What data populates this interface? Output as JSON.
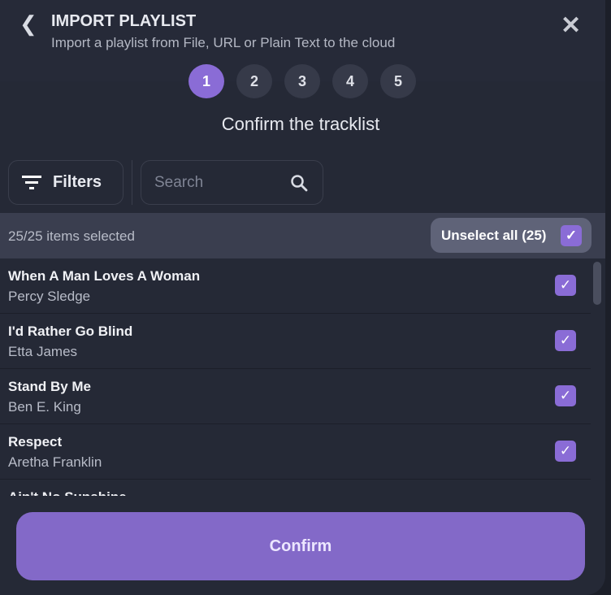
{
  "header": {
    "title": "IMPORT PLAYLIST",
    "subtitle": "Import a playlist from File, URL or Plain Text to the cloud"
  },
  "steps": [
    "1",
    "2",
    "3",
    "4",
    "5"
  ],
  "active_step": 1,
  "heading": "Confirm the tracklist",
  "toolbar": {
    "filters_label": "Filters",
    "search_placeholder": "Search"
  },
  "selection": {
    "count_text": "25/25 items selected",
    "unselect_label": "Unselect all (25)"
  },
  "tracks": [
    {
      "title": "When A Man Loves A Woman",
      "artist": "Percy Sledge",
      "checked": true
    },
    {
      "title": "I'd Rather Go Blind",
      "artist": "Etta James",
      "checked": true
    },
    {
      "title": "Stand By Me",
      "artist": "Ben E. King",
      "checked": true
    },
    {
      "title": "Respect",
      "artist": "Aretha Franklin",
      "checked": true
    },
    {
      "title": "Ain't No Sunshine",
      "artist": "",
      "checked": true
    }
  ],
  "confirm_label": "Confirm",
  "colors": {
    "accent": "#8a6cd6",
    "button": "#8369c8",
    "background": "#252936"
  }
}
